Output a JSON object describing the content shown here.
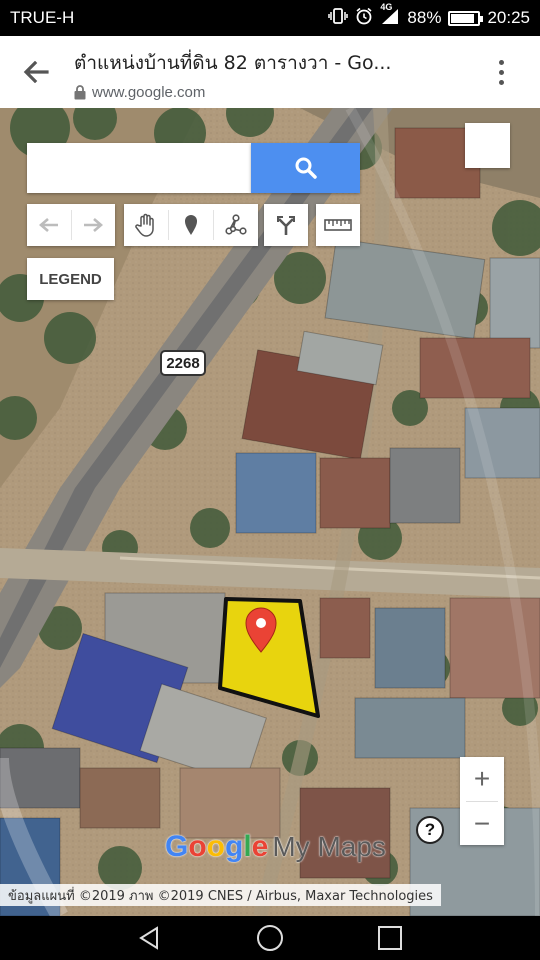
{
  "status_bar": {
    "carrier": "TRUE-H",
    "network": "4G",
    "battery_percent": "88%",
    "battery_level": 0.88,
    "time": "20:25"
  },
  "browser": {
    "page_title": "ตำแหน่งบ้านที่ดิน 82 ตารางวา - Go...",
    "url": "www.google.com"
  },
  "map": {
    "search": {
      "value": "",
      "placeholder": ""
    },
    "tools": [
      "undo-icon",
      "redo-icon",
      "hand-icon",
      "marker-icon",
      "line-icon",
      "directions-icon",
      "ruler-icon"
    ],
    "legend_label": "LEGEND",
    "road_number": "2268",
    "zoom_in_label": "+",
    "zoom_out_label": "−",
    "help_label": "?",
    "logo": {
      "g1": "G",
      "o1": "o",
      "o2": "o",
      "g2": "g",
      "l": "l",
      "e": "e",
      "product": "My Maps"
    },
    "attribution": "ข้อมูลแผนที่ ©2019 ภาพ ©2019 CNES / Airbus, Maxar Technologies",
    "colors": {
      "polygon_fill": "#e8d40e",
      "pin": "#ea4335",
      "search_button": "#4d8ff0"
    }
  }
}
